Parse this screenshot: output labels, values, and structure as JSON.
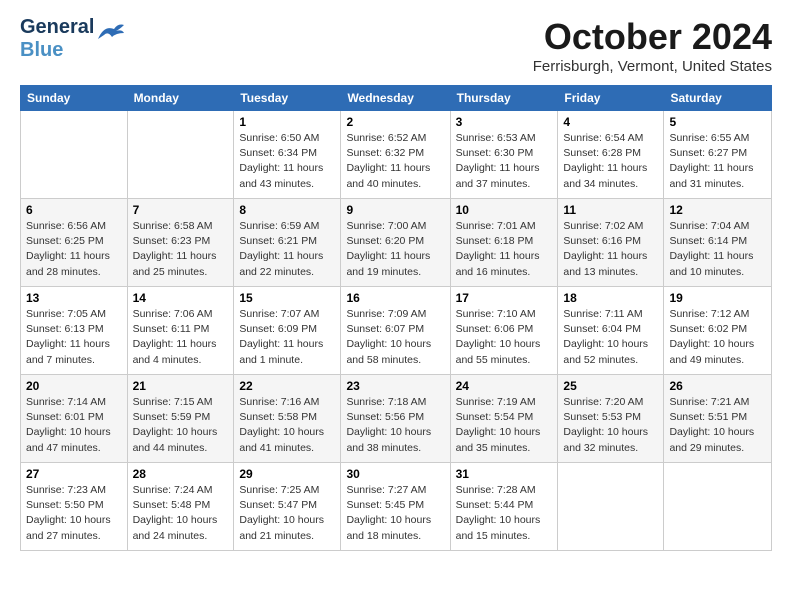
{
  "header": {
    "logo_line1": "General",
    "logo_line2": "Blue",
    "month_title": "October 2024",
    "location": "Ferrisburgh, Vermont, United States"
  },
  "days_of_week": [
    "Sunday",
    "Monday",
    "Tuesday",
    "Wednesday",
    "Thursday",
    "Friday",
    "Saturday"
  ],
  "weeks": [
    [
      {
        "day": "",
        "info": ""
      },
      {
        "day": "",
        "info": ""
      },
      {
        "day": "1",
        "info": "Sunrise: 6:50 AM\nSunset: 6:34 PM\nDaylight: 11 hours\nand 43 minutes."
      },
      {
        "day": "2",
        "info": "Sunrise: 6:52 AM\nSunset: 6:32 PM\nDaylight: 11 hours\nand 40 minutes."
      },
      {
        "day": "3",
        "info": "Sunrise: 6:53 AM\nSunset: 6:30 PM\nDaylight: 11 hours\nand 37 minutes."
      },
      {
        "day": "4",
        "info": "Sunrise: 6:54 AM\nSunset: 6:28 PM\nDaylight: 11 hours\nand 34 minutes."
      },
      {
        "day": "5",
        "info": "Sunrise: 6:55 AM\nSunset: 6:27 PM\nDaylight: 11 hours\nand 31 minutes."
      }
    ],
    [
      {
        "day": "6",
        "info": "Sunrise: 6:56 AM\nSunset: 6:25 PM\nDaylight: 11 hours\nand 28 minutes."
      },
      {
        "day": "7",
        "info": "Sunrise: 6:58 AM\nSunset: 6:23 PM\nDaylight: 11 hours\nand 25 minutes."
      },
      {
        "day": "8",
        "info": "Sunrise: 6:59 AM\nSunset: 6:21 PM\nDaylight: 11 hours\nand 22 minutes."
      },
      {
        "day": "9",
        "info": "Sunrise: 7:00 AM\nSunset: 6:20 PM\nDaylight: 11 hours\nand 19 minutes."
      },
      {
        "day": "10",
        "info": "Sunrise: 7:01 AM\nSunset: 6:18 PM\nDaylight: 11 hours\nand 16 minutes."
      },
      {
        "day": "11",
        "info": "Sunrise: 7:02 AM\nSunset: 6:16 PM\nDaylight: 11 hours\nand 13 minutes."
      },
      {
        "day": "12",
        "info": "Sunrise: 7:04 AM\nSunset: 6:14 PM\nDaylight: 11 hours\nand 10 minutes."
      }
    ],
    [
      {
        "day": "13",
        "info": "Sunrise: 7:05 AM\nSunset: 6:13 PM\nDaylight: 11 hours\nand 7 minutes."
      },
      {
        "day": "14",
        "info": "Sunrise: 7:06 AM\nSunset: 6:11 PM\nDaylight: 11 hours\nand 4 minutes."
      },
      {
        "day": "15",
        "info": "Sunrise: 7:07 AM\nSunset: 6:09 PM\nDaylight: 11 hours\nand 1 minute."
      },
      {
        "day": "16",
        "info": "Sunrise: 7:09 AM\nSunset: 6:07 PM\nDaylight: 10 hours\nand 58 minutes."
      },
      {
        "day": "17",
        "info": "Sunrise: 7:10 AM\nSunset: 6:06 PM\nDaylight: 10 hours\nand 55 minutes."
      },
      {
        "day": "18",
        "info": "Sunrise: 7:11 AM\nSunset: 6:04 PM\nDaylight: 10 hours\nand 52 minutes."
      },
      {
        "day": "19",
        "info": "Sunrise: 7:12 AM\nSunset: 6:02 PM\nDaylight: 10 hours\nand 49 minutes."
      }
    ],
    [
      {
        "day": "20",
        "info": "Sunrise: 7:14 AM\nSunset: 6:01 PM\nDaylight: 10 hours\nand 47 minutes."
      },
      {
        "day": "21",
        "info": "Sunrise: 7:15 AM\nSunset: 5:59 PM\nDaylight: 10 hours\nand 44 minutes."
      },
      {
        "day": "22",
        "info": "Sunrise: 7:16 AM\nSunset: 5:58 PM\nDaylight: 10 hours\nand 41 minutes."
      },
      {
        "day": "23",
        "info": "Sunrise: 7:18 AM\nSunset: 5:56 PM\nDaylight: 10 hours\nand 38 minutes."
      },
      {
        "day": "24",
        "info": "Sunrise: 7:19 AM\nSunset: 5:54 PM\nDaylight: 10 hours\nand 35 minutes."
      },
      {
        "day": "25",
        "info": "Sunrise: 7:20 AM\nSunset: 5:53 PM\nDaylight: 10 hours\nand 32 minutes."
      },
      {
        "day": "26",
        "info": "Sunrise: 7:21 AM\nSunset: 5:51 PM\nDaylight: 10 hours\nand 29 minutes."
      }
    ],
    [
      {
        "day": "27",
        "info": "Sunrise: 7:23 AM\nSunset: 5:50 PM\nDaylight: 10 hours\nand 27 minutes."
      },
      {
        "day": "28",
        "info": "Sunrise: 7:24 AM\nSunset: 5:48 PM\nDaylight: 10 hours\nand 24 minutes."
      },
      {
        "day": "29",
        "info": "Sunrise: 7:25 AM\nSunset: 5:47 PM\nDaylight: 10 hours\nand 21 minutes."
      },
      {
        "day": "30",
        "info": "Sunrise: 7:27 AM\nSunset: 5:45 PM\nDaylight: 10 hours\nand 18 minutes."
      },
      {
        "day": "31",
        "info": "Sunrise: 7:28 AM\nSunset: 5:44 PM\nDaylight: 10 hours\nand 15 minutes."
      },
      {
        "day": "",
        "info": ""
      },
      {
        "day": "",
        "info": ""
      }
    ]
  ]
}
